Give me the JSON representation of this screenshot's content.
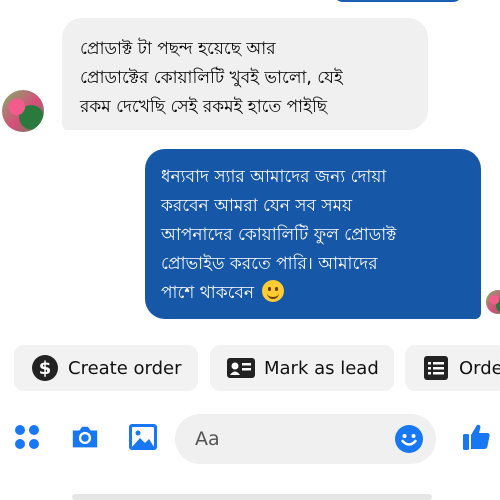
{
  "messages": {
    "received": {
      "lines": [
        "প্রোডাক্ট টা পছন্দ হয়েছে আর",
        "প্রোডাক্টের কোয়ালিটি খুবই ভালো, যেই",
        "রকম দেখেছি সেই রকমই হাতে পাইছি"
      ]
    },
    "sent": {
      "lines": [
        "ধন্যবাদ স্যার আমাদের জন্য দোয়া",
        "করবেন  আমরা যেন সব সময়",
        "আপনাদের কোয়ালিটি ফুল প্রোডাক্ট",
        "প্রোভাইড করতে পারি।  আমাদের",
        "পাশে থাকবেন"
      ],
      "emoji": "smiling-face"
    }
  },
  "quick_actions": [
    {
      "label": "Create order",
      "icon": "dollar-icon"
    },
    {
      "label": "Mark as lead",
      "icon": "contact-card-icon"
    },
    {
      "label": "Orde",
      "icon": "list-icon"
    }
  ],
  "composer": {
    "placeholder": "Aa",
    "tools": [
      "menu-icon",
      "camera-icon",
      "gallery-icon",
      "emoji-icon",
      "like-icon"
    ]
  },
  "colors": {
    "accent": "#1877f2",
    "sent_bubble": "#1657a8",
    "received_bubble": "#f0f0f0"
  }
}
